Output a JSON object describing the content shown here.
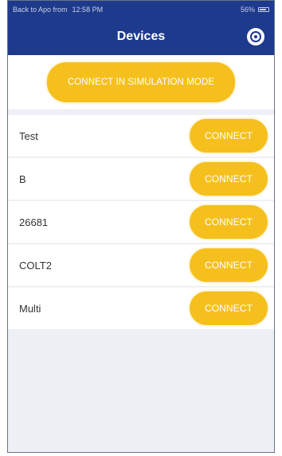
{
  "status_bar": {
    "back_text": "Back to Apo from",
    "time": "12:58 PM",
    "battery": "56%"
  },
  "nav": {
    "title": "Devices",
    "settings_icon": "settings-icon"
  },
  "simulation_button": "CONNECT IN SIMULATION MODE",
  "devices": [
    {
      "name": "Test",
      "button": "CONNECT"
    },
    {
      "name": "B",
      "button": "CONNECT"
    },
    {
      "name": "26681",
      "button": "CONNECT"
    },
    {
      "name": "COLT2",
      "button": "CONNECT"
    },
    {
      "name": "Multi",
      "button": "CONNECT"
    }
  ],
  "colors": {
    "nav_bg": "#1e3a8c",
    "accent": "#f5c01e",
    "page_bg": "#eef0f5"
  }
}
